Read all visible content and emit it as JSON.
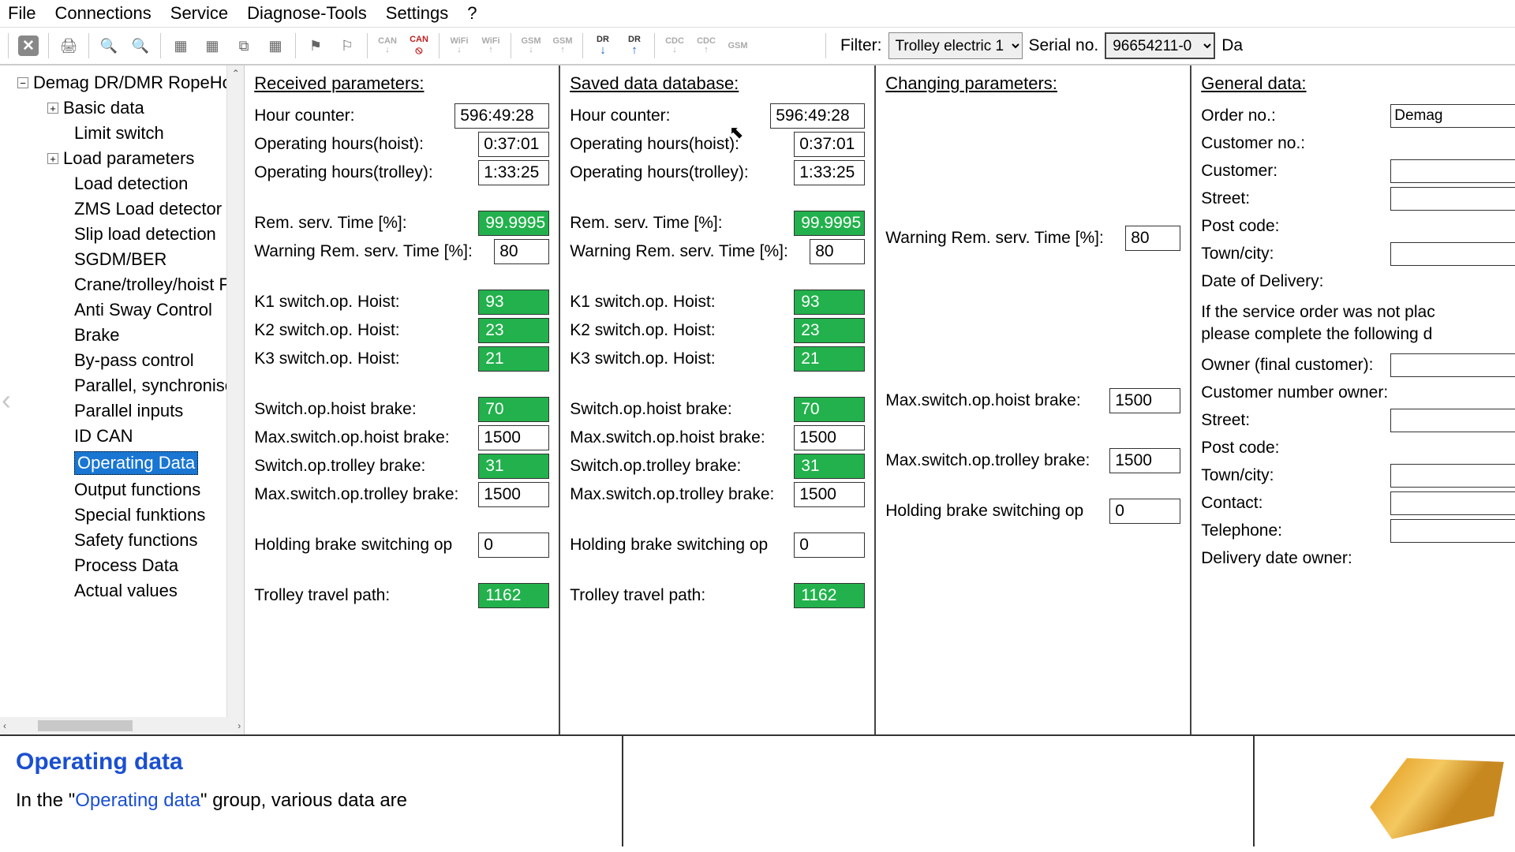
{
  "menu": {
    "file": "File",
    "connections": "Connections",
    "service": "Service",
    "diagnose": "Diagnose-Tools",
    "settings": "Settings",
    "help": "?"
  },
  "toolbar": {
    "labels": {
      "can1": "CAN",
      "can2": "CAN",
      "wifi1": "WiFi",
      "wifi2": "WiFi",
      "gsm1": "GSM",
      "gsm2": "GSM",
      "dr1": "DR",
      "dr2": "DR",
      "cdc1": "CDC",
      "cdc2": "CDC",
      "gsm3": "GSM"
    }
  },
  "filter": {
    "label": "Filter:",
    "value": "Trolley electric 1",
    "serial_label": "Serial no.",
    "serial_value": "96654211-0",
    "data_label": "Da"
  },
  "tree": {
    "root": "Demag DR/DMR RopeHo",
    "items": [
      {
        "label": "Basic data",
        "expandable": true
      },
      {
        "label": "Limit switch"
      },
      {
        "label": "Load parameters",
        "expandable": true
      },
      {
        "label": "Load detection"
      },
      {
        "label": "ZMS Load detector"
      },
      {
        "label": "Slip load detection"
      },
      {
        "label": "SGDM/BER"
      },
      {
        "label": "Crane/trolley/hoist FI"
      },
      {
        "label": "Anti Sway Control"
      },
      {
        "label": "Brake"
      },
      {
        "label": "By-pass control"
      },
      {
        "label": "Parallel, synchronised"
      },
      {
        "label": "Parallel inputs"
      },
      {
        "label": "ID CAN"
      },
      {
        "label": "Operating Data",
        "selected": true
      },
      {
        "label": "Output functions"
      },
      {
        "label": "Special funktions"
      },
      {
        "label": "Safety functions"
      },
      {
        "label": "Process Data"
      },
      {
        "label": "Actual values"
      }
    ]
  },
  "received": {
    "title": "Received parameters:",
    "hour_counter_l": "Hour counter:",
    "hour_counter_v": "596:49:28",
    "op_hoist_l": "Operating hours(hoist):",
    "op_hoist_v": "0:37:01",
    "op_trolley_l": "Operating hours(trolley):",
    "op_trolley_v": "1:33:25",
    "rem_l": "Rem. serv. Time [%]:",
    "rem_v": "99.9995",
    "warn_l": "Warning Rem. serv. Time [%]:",
    "warn_v": "80",
    "k1_l": "K1 switch.op. Hoist:",
    "k1_v": "93",
    "k2_l": "K2 switch.op. Hoist:",
    "k2_v": "23",
    "k3_l": "K3 switch.op. Hoist:",
    "k3_v": "21",
    "sohb_l": "Switch.op.hoist brake:",
    "sohb_v": "70",
    "msohb_l": "Max.switch.op.hoist brake:",
    "msohb_v": "1500",
    "sotb_l": "Switch.op.trolley brake:",
    "sotb_v": "31",
    "msotb_l": "Max.switch.op.trolley brake:",
    "msotb_v": "1500",
    "hold_l": "Holding brake switching op",
    "hold_v": "0",
    "ttp_l": "Trolley travel path:",
    "ttp_v": "1162"
  },
  "saved": {
    "title": "Saved data database:",
    "hour_counter_l": "Hour counter:",
    "hour_counter_v": "596:49:28",
    "op_hoist_l": "Operating hours(hoist):",
    "op_hoist_v": "0:37:01",
    "op_trolley_l": "Operating hours(trolley):",
    "op_trolley_v": "1:33:25",
    "rem_l": "Rem. serv. Time [%]:",
    "rem_v": "99.9995",
    "warn_l": "Warning Rem. serv. Time [%]:",
    "warn_v": "80",
    "k1_l": "K1 switch.op. Hoist:",
    "k1_v": "93",
    "k2_l": "K2 switch.op. Hoist:",
    "k2_v": "23",
    "k3_l": "K3 switch.op. Hoist:",
    "k3_v": "21",
    "sohb_l": "Switch.op.hoist brake:",
    "sohb_v": "70",
    "msohb_l": "Max.switch.op.hoist brake:",
    "msohb_v": "1500",
    "sotb_l": "Switch.op.trolley brake:",
    "sotb_v": "31",
    "msotb_l": "Max.switch.op.trolley brake:",
    "msotb_v": "1500",
    "hold_l": "Holding brake switching op",
    "hold_v": "0",
    "ttp_l": "Trolley travel path:",
    "ttp_v": "1162"
  },
  "changing": {
    "title": "Changing parameters:",
    "warn_l": "Warning Rem. serv. Time [%]:",
    "warn_v": "80",
    "msohb_l": "Max.switch.op.hoist brake:",
    "msohb_v": "1500",
    "msotb_l": "Max.switch.op.trolley brake:",
    "msotb_v": "1500",
    "hold_l": "Holding brake switching op",
    "hold_v": "0"
  },
  "general": {
    "title": "General data:",
    "order_no_l": "Order no.:",
    "order_no_v": "Demag",
    "customer_no_l": "Customer no.:",
    "customer_l": "Customer:",
    "street_l": "Street:",
    "postcode_l": "Post code:",
    "town_l": "Town/city:",
    "delivery_l": "Date of Delivery:",
    "note1": "If the service order was not plac",
    "note2": "please complete the following d",
    "owner_l": "Owner (final customer):",
    "owner_no_l": "Customer number owner:",
    "street2_l": "Street:",
    "postcode2_l": "Post code:",
    "town2_l": "Town/city:",
    "contact_l": "Contact:",
    "tel_l": "Telephone:",
    "delivery2_l": "Delivery date owner:"
  },
  "bottom": {
    "title": "Operating data",
    "text_pre": "In the \"",
    "text_link": "Operating data",
    "text_post": "\" group, various data are"
  }
}
